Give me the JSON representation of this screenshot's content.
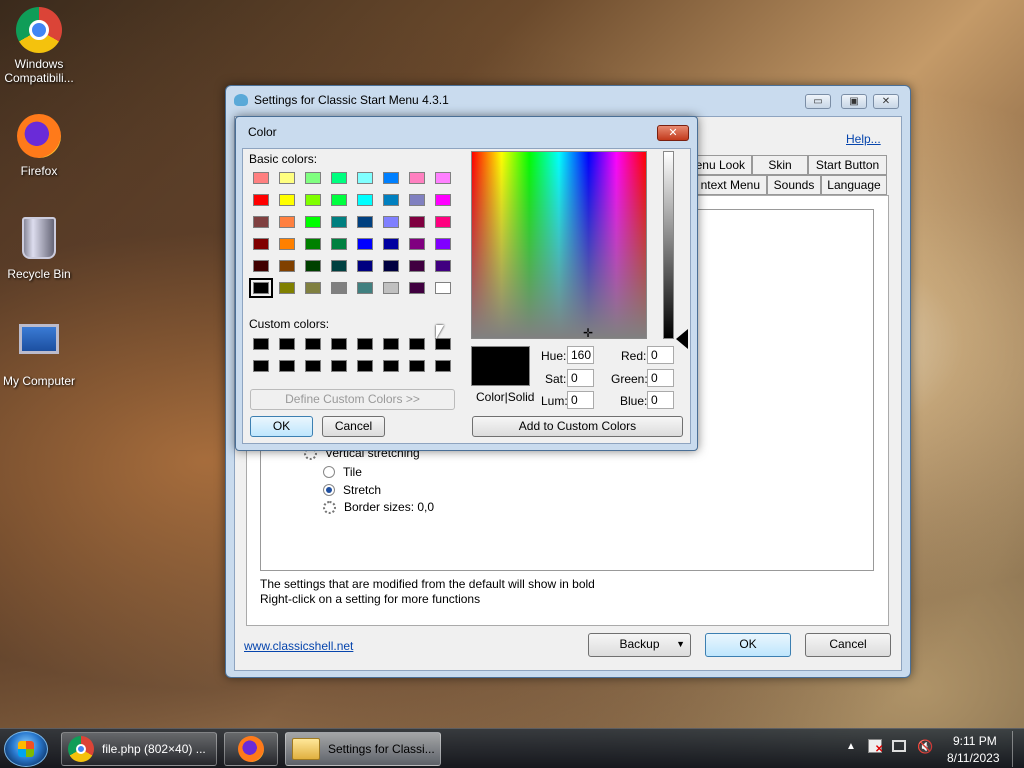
{
  "desktop": {
    "icons": [
      {
        "label": "Windows Compatibili..."
      },
      {
        "label": "Firefox"
      },
      {
        "label": "Recycle Bin"
      },
      {
        "label": "My Computer"
      }
    ]
  },
  "settings_window": {
    "title": "Settings for Classic Start Menu 4.3.1",
    "help_link": "Help...",
    "tabs_row1": [
      "enu Look",
      "Skin",
      "Start Button"
    ],
    "tabs_row2": [
      "ntext Menu",
      "Sounds",
      "Language"
    ],
    "tree": {
      "vertical_stretching": "Vertical stretching",
      "tile": "Tile",
      "stretch": "Stretch",
      "border_sizes": "Border sizes: 0,0"
    },
    "info_line1": "The settings that are modified from the default will show in bold",
    "info_line2": "Right-click on a setting for more functions",
    "website_link": "www.classicshell.net",
    "backup_button": "Backup",
    "ok_button": "OK",
    "cancel_button": "Cancel"
  },
  "color_dialog": {
    "title": "Color",
    "basic_colors_label": "Basic colors:",
    "custom_colors_label": "Custom colors:",
    "define_custom_button": "Define Custom Colors >>",
    "ok_button": "OK",
    "cancel_button": "Cancel",
    "color_solid_label": "Color|Solid",
    "hue_label": "Hue:",
    "sat_label": "Sat:",
    "lum_label": "Lum:",
    "red_label": "Red:",
    "green_label": "Green:",
    "blue_label": "Blue:",
    "hue": "160",
    "sat": "0",
    "lum": "0",
    "red": "0",
    "green": "0",
    "blue": "0",
    "add_custom_button": "Add to Custom Colors",
    "basic_colors": [
      [
        "#ff8080",
        "#ffff80",
        "#80ff80",
        "#00ff80",
        "#80ffff",
        "#0080ff",
        "#ff80c0",
        "#ff80ff"
      ],
      [
        "#ff0000",
        "#ffff00",
        "#80ff00",
        "#00ff40",
        "#00ffff",
        "#0080c0",
        "#8080c0",
        "#ff00ff"
      ],
      [
        "#804040",
        "#ff8040",
        "#00ff00",
        "#008080",
        "#004080",
        "#8080ff",
        "#800040",
        "#ff0080"
      ],
      [
        "#800000",
        "#ff8000",
        "#008000",
        "#008040",
        "#0000ff",
        "#0000a0",
        "#800080",
        "#8000ff"
      ],
      [
        "#400000",
        "#804000",
        "#004000",
        "#004040",
        "#000080",
        "#000040",
        "#400040",
        "#400080"
      ],
      [
        "#000000",
        "#808000",
        "#808040",
        "#808080",
        "#408080",
        "#c0c0c0",
        "#400040",
        "#ffffff"
      ]
    ],
    "custom_colors": [
      [
        "#000000",
        "#000000",
        "#000000",
        "#000000",
        "#000000",
        "#000000",
        "#000000",
        "#000000"
      ],
      [
        "#000000",
        "#000000",
        "#000000",
        "#000000",
        "#000000",
        "#000000",
        "#000000",
        "#000000"
      ]
    ]
  },
  "taskbar": {
    "task1": "file.php (802×40) ...",
    "task3": "Settings for Classi...",
    "time": "9:11 PM",
    "date": "8/11/2023"
  }
}
